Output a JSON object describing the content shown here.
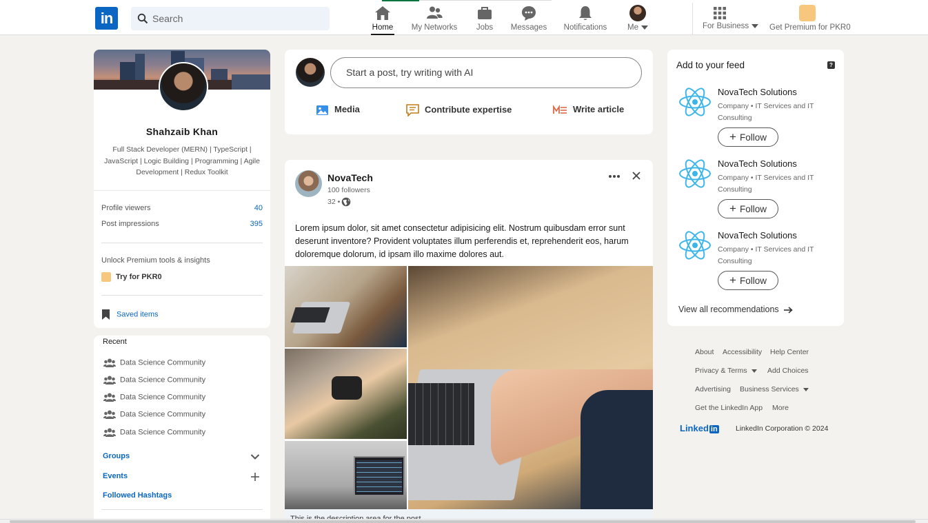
{
  "nav": {
    "logo": "in",
    "search_placeholder": "Search",
    "items": [
      {
        "label": "Home",
        "icon": "home-icon"
      },
      {
        "label": "My Networks",
        "icon": "network-icon"
      },
      {
        "label": "Jobs",
        "icon": "briefcase-icon"
      },
      {
        "label": "Messages",
        "icon": "message-icon"
      },
      {
        "label": "Notifications",
        "icon": "bell-icon"
      },
      {
        "label": "Me",
        "icon": "avatar"
      }
    ],
    "business_label": "For Business",
    "premium_label": "Get Premium for PKR0",
    "accent_color": "#0a66c2"
  },
  "profile": {
    "name": "Shahzaib Khan",
    "headline": "Full Stack Developer (MERN) | TypeScript | JavaScript | Logic Building | Programming | Agile Development | Redux Toolkit",
    "stats": [
      {
        "label": "Profile viewers",
        "value": "40"
      },
      {
        "label": "Post impressions",
        "value": "395"
      }
    ],
    "premium_prompt": "Unlock Premium tools & insights",
    "premium_cta": "Try for PKR0",
    "saved_items": "Saved items"
  },
  "recent": {
    "title": "Recent",
    "items": [
      "Data Science Community",
      "Data Science Community",
      "Data Science Community",
      "Data Science Community",
      "Data Science Community"
    ],
    "groups": "Groups",
    "events": "Events",
    "hashtags": "Followed Hashtags"
  },
  "composer": {
    "placeholder": "Start a post, try writing with AI",
    "actions": [
      "Media",
      "Contribute expertise",
      "Write article"
    ]
  },
  "post": {
    "author": "NovaTech",
    "followers": "100 followers",
    "time": "32 •",
    "text": "Lorem ipsum dolor, sit amet consectetur adipisicing elit. Nostrum quibusdam error sunt deserunt inventore? Provident voluptates illum perferendis et, reprehenderit eos, harum doloremque dolorum, id ipsam illo maxime dolores aut.",
    "description": "This is the description area for the post"
  },
  "feed": {
    "title": "Add to your feed",
    "info": "?",
    "recommendations": [
      {
        "name": "NovaTech Solutions",
        "sub": "Company • IT Services and IT Consulting",
        "button": "Follow"
      },
      {
        "name": "NovaTech Solutions",
        "sub": "Company • IT Services and IT Consulting",
        "button": "Follow"
      },
      {
        "name": "NovaTech Solutions",
        "sub": "Company • IT Services and IT Consulting",
        "button": "Follow"
      }
    ],
    "view_all": "View all recommendations"
  },
  "footer": {
    "about": "About",
    "accessibility": "Accessibility",
    "help": "Help Center",
    "privacy": "Privacy & Terms",
    "ad_choices": "Add Choices",
    "advertising": "Advertising",
    "business_services": "Business Services",
    "app": "Get the LinkedIn App",
    "more": "More",
    "logo_text": "Linked",
    "logo_in": "in",
    "copyright": "LinkedIn Corporation © 2024"
  }
}
